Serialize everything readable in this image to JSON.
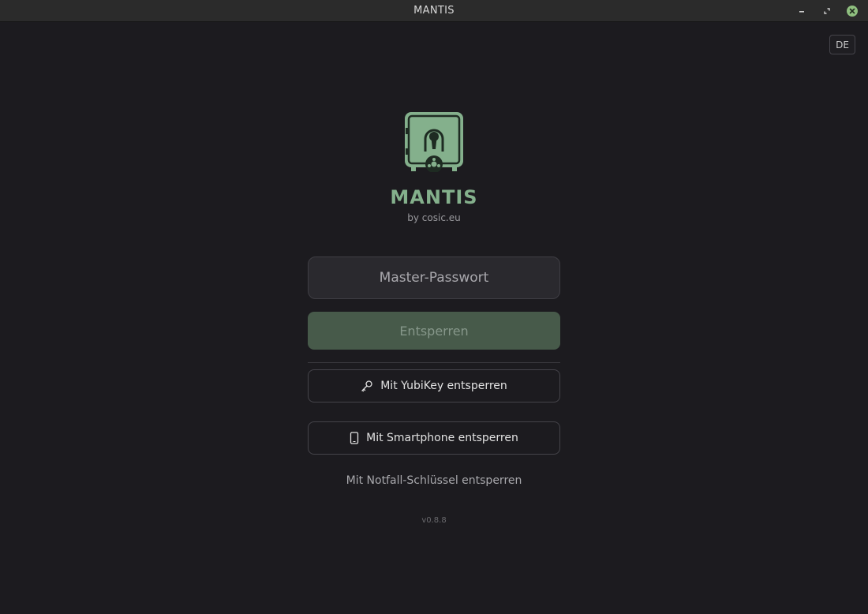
{
  "window": {
    "title": "MANTIS",
    "controls": [
      "minimize-icon",
      "maximize-icon",
      "close-icon"
    ]
  },
  "language": {
    "label": "DE"
  },
  "app": {
    "name": "MANTIS",
    "byline": "by cosic.eu",
    "logo_icon": "vault-safe-keyhole-icon",
    "accent_color": "#84b08c"
  },
  "login": {
    "password_placeholder": "Master-Passwort",
    "unlock_label": "Entsperren",
    "yubikey_label": "Mit YubiKey entsperren",
    "yubikey_icon": "key-icon",
    "smartphone_label": "Mit Smartphone entsperren",
    "smartphone_icon": "smartphone-icon",
    "emergency_label": "Mit Notfall-Schlüssel entsperren"
  },
  "version": "v0.8.8"
}
